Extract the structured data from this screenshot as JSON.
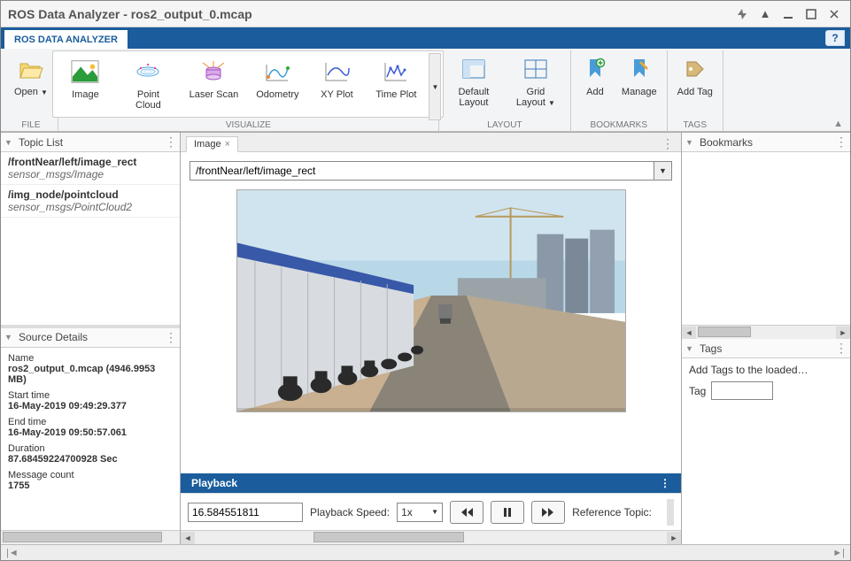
{
  "window": {
    "title": "ROS Data Analyzer - ros2_output_0.mcap"
  },
  "ribbon_tab": "ROS DATA ANALYZER",
  "ribbon": {
    "file": {
      "label": "FILE",
      "open": "Open"
    },
    "visualize": {
      "label": "VISUALIZE",
      "image": "Image",
      "pointcloud": "Point Cloud",
      "laserscan": "Laser Scan",
      "odometry": "Odometry",
      "xyplot": "XY Plot",
      "timeplot": "Time Plot"
    },
    "layout": {
      "label": "LAYOUT",
      "default": "Default Layout",
      "grid": "Grid Layout"
    },
    "bookmarks": {
      "label": "BOOKMARKS",
      "add": "Add",
      "manage": "Manage"
    },
    "tags": {
      "label": "TAGS",
      "addtag": "Add Tag"
    }
  },
  "left": {
    "topic_list_title": "Topic List",
    "topics": [
      {
        "name": "/frontNear/left/image_rect",
        "type": "sensor_msgs/Image"
      },
      {
        "name": "/img_node/pointcloud",
        "type": "sensor_msgs/PointCloud2"
      }
    ],
    "source_title": "Source Details",
    "src": {
      "name_lbl": "Name",
      "name": "ros2_output_0.mcap (4946.9953 MB)",
      "start_lbl": "Start time",
      "start": "16-May-2019 09:49:29.377",
      "end_lbl": "End time",
      "end": "16-May-2019 09:50:57.061",
      "dur_lbl": "Duration",
      "dur": "87.68459224700928 Sec",
      "cnt_lbl": "Message count",
      "cnt": "1755"
    }
  },
  "center": {
    "tab": "Image",
    "topic_selection": "/frontNear/left/image_rect",
    "playback_title": "Playback",
    "time": "16.584551811",
    "speed_lbl": "Playback Speed:",
    "speed": "1x",
    "reftopic_lbl": "Reference Topic:"
  },
  "right": {
    "bookmarks_title": "Bookmarks",
    "tags_title": "Tags",
    "tags_hint": "Add Tags to the loaded…",
    "tag_lbl": "Tag"
  }
}
